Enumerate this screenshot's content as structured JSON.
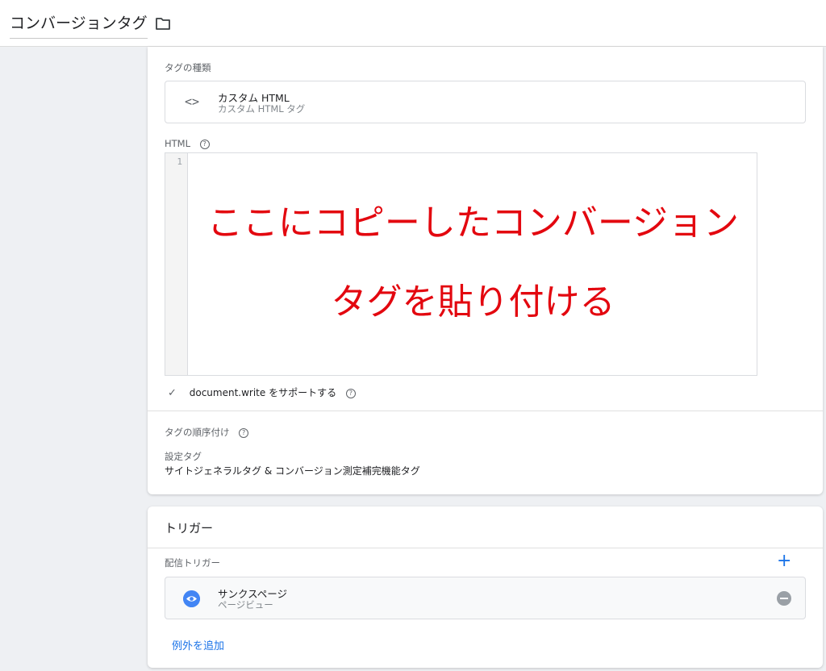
{
  "header": {
    "title": "コンバージョンタグ",
    "folder_icon": "folder-icon"
  },
  "tag_config": {
    "type_label": "タグの種類",
    "type_title": "カスタム HTML",
    "type_subtitle": "カスタム HTML タグ",
    "html_label": "HTML",
    "editor": {
      "line_number": "1"
    },
    "overlay_line1": "ここにコピーしたコンバージョン",
    "overlay_line2": "タグを貼り付ける",
    "support_document_write": "document.write をサポートする",
    "sequencing_label": "タグの順序付け",
    "setup_tag_label": "設定タグ",
    "setup_tag_value": "サイトジェネラルタグ & コンバージョン測定補完機能タグ"
  },
  "triggering": {
    "title": "トリガー",
    "firing_label": "配信トリガー",
    "add_label": "+",
    "trigger_name": "サンクスページ",
    "trigger_type": "ページビュー",
    "add_exception": "例外を追加"
  },
  "colors": {
    "accent": "#1a73e8",
    "overlay_text": "#e3070f",
    "trigger_icon": "#4285f4"
  }
}
